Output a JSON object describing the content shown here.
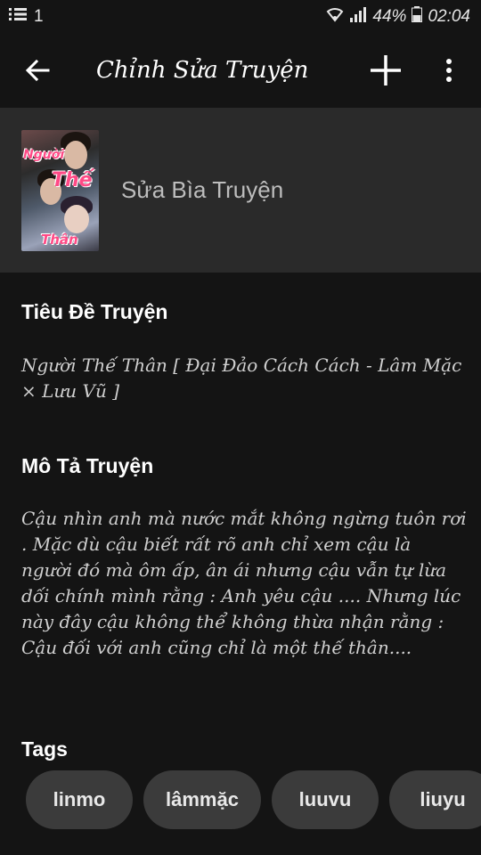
{
  "status_bar": {
    "notification_count": "1",
    "battery": "44%",
    "time": "02:04"
  },
  "toolbar": {
    "title": "Chỉnh Sửa Truyện"
  },
  "cover": {
    "label": "Sửa Bìa Truyện",
    "art_title_1": "Người",
    "art_title_2": "Thế",
    "art_title_3": "Thân"
  },
  "story_title": {
    "heading": "Tiêu Đề Truyện",
    "value": "Người Thế Thân [ Đại Đảo Cách Cách - Lâm Mặc × Lưu Vũ ]"
  },
  "description": {
    "heading": "Mô Tả Truyện",
    "value": "Cậu nhìn anh mà nước mắt không ngừng tuôn rơi . Mặc dù cậu biết rất rõ anh chỉ xem cậu là người đó mà ôm ấp, ân ái nhưng cậu vẫn tự lừa dối chính mình rằng : Anh yêu cậu .... Nhưng lúc này đây cậu không thể không thừa nhận rằng : Cậu đối với anh cũng chỉ là một thế thân...."
  },
  "tags": {
    "heading": "Tags",
    "items": [
      "linmo",
      "lâmmặc",
      "luuvu",
      "liuyu"
    ]
  },
  "colors": {
    "background": "#141414",
    "panel": "#2a2a2a",
    "chip": "#3b3b3b",
    "accent_pink": "#ff4a86"
  },
  "icons": {
    "back": "arrow-left-icon",
    "add": "plus-icon",
    "more": "more-vert-icon"
  }
}
